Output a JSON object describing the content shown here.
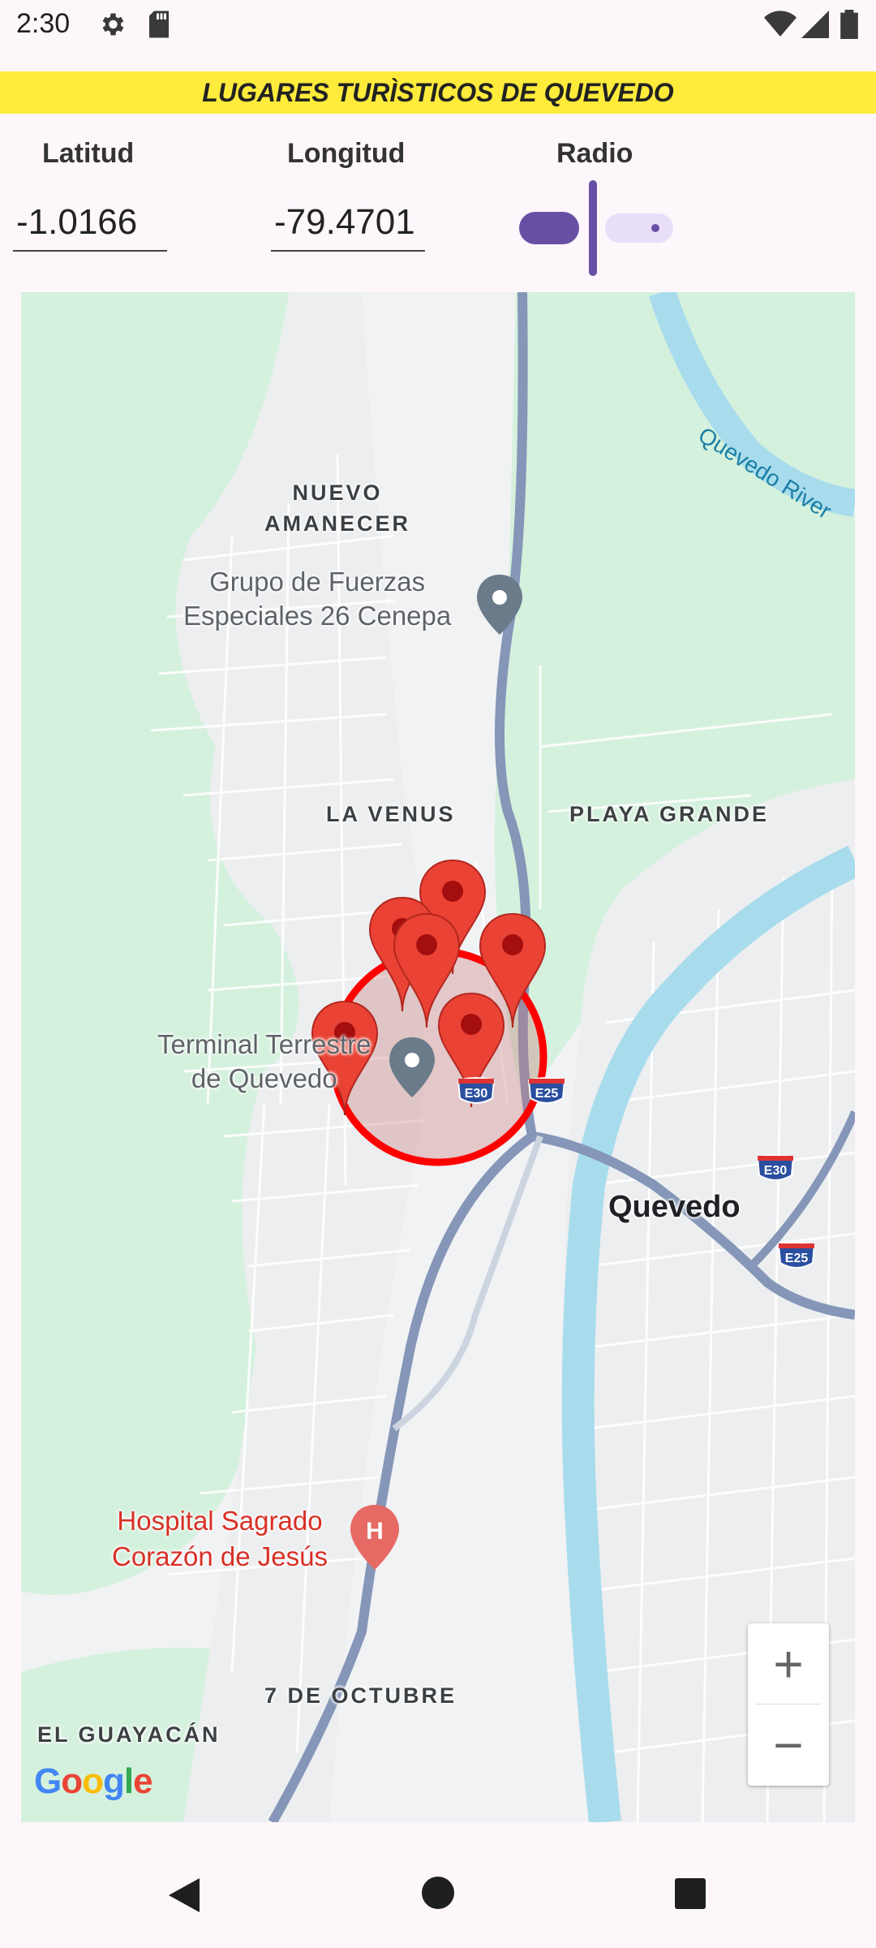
{
  "status_bar": {
    "time": "2:30",
    "icons": [
      "settings-icon",
      "sd-card-icon",
      "wifi-icon",
      "signal-icon",
      "battery-icon"
    ]
  },
  "title": "LUGARES TURÌSTICOS DE QUEVEDO",
  "controls": {
    "latitude_label": "Latitud",
    "latitude_value": "-1.0166",
    "longitude_label": "Longitud",
    "longitude_value": "-79.4701",
    "radius_label": "Radio",
    "radius_level": 0.2
  },
  "map": {
    "areas": [
      "NUEVO\nAMANECER",
      "LA VENUS",
      "PLAYA GRANDE",
      "7 DE OCTUBRE",
      "EL GUAYACÁN"
    ],
    "river": "Quevedo River",
    "pois": {
      "military": "Grupo de Fuerzas\nEspeciales 26 Cenepa",
      "terminal": "Terminal Terrestre\nde Quevedo",
      "hospital": "Hospital Sagrado\nCorazón de Jesús"
    },
    "city": "Quevedo",
    "highway_shields": [
      "E30",
      "E25",
      "E30",
      "E25"
    ],
    "zoom_in": "+",
    "zoom_out": "−",
    "attribution": "Google",
    "colors": {
      "marker": "#ea4335",
      "circle_stroke": "#ff0000",
      "water": "#a8dcec",
      "park": "#d4f1dd",
      "highway": "#8596b8"
    }
  },
  "nav": {
    "icons": [
      "back-icon",
      "home-icon",
      "recents-icon"
    ]
  }
}
